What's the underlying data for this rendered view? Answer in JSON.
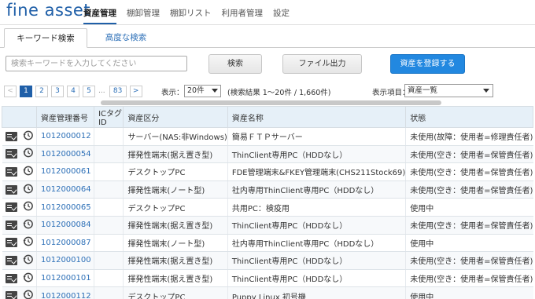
{
  "brand": "fine asset",
  "nav": [
    "資産管理",
    "棚卸管理",
    "棚卸リスト",
    "利用者管理",
    "設定"
  ],
  "tabs": {
    "keyword": "キーワード検索",
    "advanced": "高度な検索"
  },
  "search": {
    "placeholder": "検索キーワードを入力してください",
    "search_label": "検索",
    "export_label": "ファイル出力",
    "register_label": "資産を登録する"
  },
  "pagination": {
    "prev": "<",
    "pages": [
      "1",
      "2",
      "3",
      "4",
      "5"
    ],
    "dots": "...",
    "last": "83",
    "next": ">",
    "current": "1"
  },
  "display": {
    "label": "表示：",
    "count": "20件",
    "result": "(検索結果 1〜20件 / 1,660件)",
    "items_label": "表示項目：",
    "items_value": "資産一覧"
  },
  "table": {
    "headers": [
      "資産管理番号",
      "ICタグ ID",
      "資産区分",
      "資産名称",
      "状態"
    ],
    "rows": [
      [
        "1012000012",
        "",
        "サーバー(NAS:非Windows)",
        "簡易ＦＴＰサーバー",
        "未使用(故障：使用者=修理責任者)"
      ],
      [
        "1012000054",
        "",
        "揮発性端末(据え置き型)",
        "ThinClient専用PC（HDDなし）",
        "未使用(空き：使用者=保管責任者)"
      ],
      [
        "1012000061",
        "",
        "デスクトップPC",
        "FDE管理端末&FKEY管理端末(CHS211Stock69)",
        "未使用(空き：使用者=保管責任者)"
      ],
      [
        "1012000064",
        "",
        "揮発性端末(ノート型)",
        "社内専用ThinClient専用PC（HDDなし）",
        "未使用(空き：使用者=保管責任者)"
      ],
      [
        "1012000065",
        "",
        "デスクトップPC",
        "共用PC：検疫用",
        "使用中"
      ],
      [
        "1012000084",
        "",
        "揮発性端末(据え置き型)",
        "ThinClient専用PC（HDDなし）",
        "未使用(空き：使用者=保管責任者)"
      ],
      [
        "1012000087",
        "",
        "揮発性端末(ノート型)",
        "社内専用ThinClient専用PC（HDDなし）",
        "使用中"
      ],
      [
        "1012000100",
        "",
        "揮発性端末(据え置き型)",
        "ThinClient専用PC（HDDなし）",
        "未使用(空き：使用者=保管責任者)"
      ],
      [
        "1012000101",
        "",
        "揮発性端末(据え置き型)",
        "ThinClient専用PC（HDDなし）",
        "未使用(空き：使用者=保管責任者)"
      ],
      [
        "1012000112",
        "",
        "デスクトップPC",
        "Puppy Linux 初号機",
        "使用中"
      ]
    ]
  },
  "colors": {
    "brand": "#1f5fa8",
    "primary_button": "#2288e0",
    "link": "#2c6fb7",
    "header_bg": "#e6f0f8"
  },
  "icons": {
    "row_edit": "edit-list-icon",
    "row_history": "history-icon"
  }
}
